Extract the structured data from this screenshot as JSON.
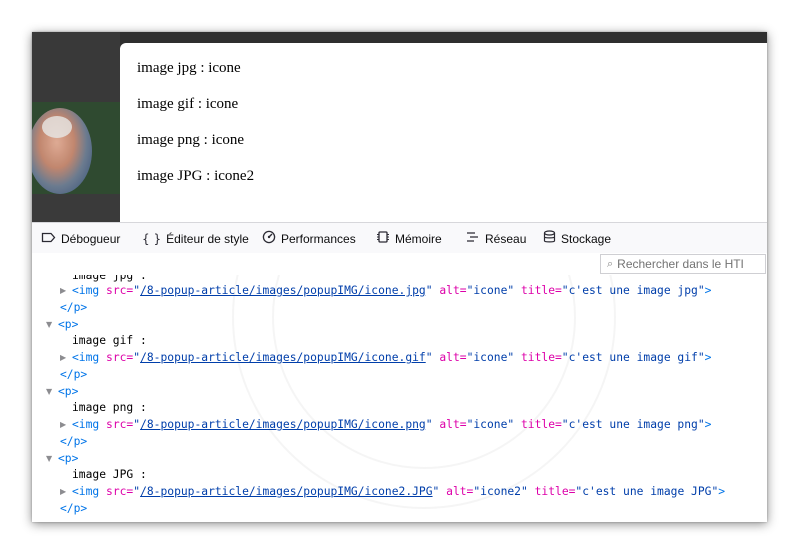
{
  "popup": {
    "lines": [
      "image jpg : icone",
      "image gif : icone",
      "image png : icone",
      "image JPG : icone2"
    ]
  },
  "toolbar": {
    "tabs": [
      {
        "label": "Débogueur",
        "icon": "debugger-icon"
      },
      {
        "label": "Éditeur de style",
        "icon": "braces-icon"
      },
      {
        "label": "Performances",
        "icon": "performance-gauge-icon"
      },
      {
        "label": "Mémoire",
        "icon": "memory-chip-icon"
      },
      {
        "label": "Réseau",
        "icon": "network-icon"
      },
      {
        "label": "Stockage",
        "icon": "storage-database-icon"
      }
    ]
  },
  "search": {
    "placeholder": "Rechercher dans le HTI"
  },
  "markup": {
    "partial_text": "image jpg :",
    "tag_img": "<img",
    "tag_p_open": "<p>",
    "tag_p_close": "</p>",
    "tag_end": ">",
    "attr_src": "src=",
    "attr_alt": "alt=",
    "attr_title": "title=",
    "quote": "\"",
    "entries": [
      {
        "text": "image jpg :",
        "src": "/8-popup-article/images/popupIMG/icone.jpg",
        "alt": "\"icone\"",
        "title": "\"c'est une image jpg\""
      },
      {
        "text": "image gif :",
        "src": "/8-popup-article/images/popupIMG/icone.gif",
        "alt": "\"icone\"",
        "title": "\"c'est une image gif\""
      },
      {
        "text": "image png :",
        "src": "/8-popup-article/images/popupIMG/icone.png",
        "alt": "\"icone\"",
        "title": "\"c'est une image png\""
      },
      {
        "text": "image JPG :",
        "src": "/8-popup-article/images/popupIMG/icone2.JPG",
        "alt": "\"icone2\"",
        "title": "\"c'est une image JPG\""
      }
    ]
  }
}
